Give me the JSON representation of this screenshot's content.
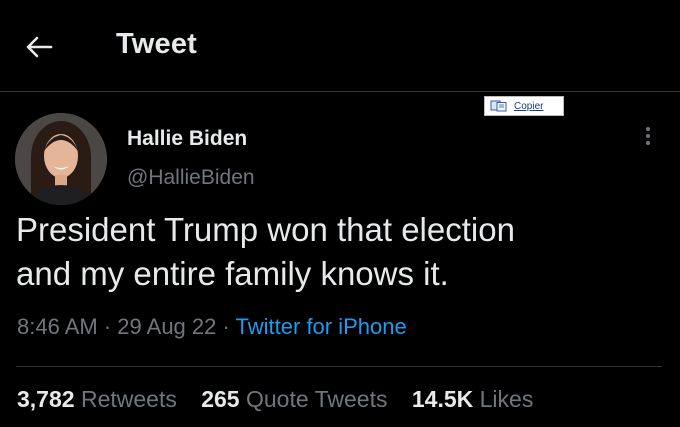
{
  "header": {
    "title": "Tweet",
    "back_icon": "arrow-left-icon"
  },
  "overlay": {
    "copier_label": "Copier",
    "copier_icon": "copy-icon"
  },
  "author": {
    "name": "Hallie Biden",
    "handle": "@HallieBiden"
  },
  "tweet": {
    "text_line1": "President Trump won that election",
    "text_line2": "and my entire family knows it.",
    "time": "8:46 AM",
    "sep1": " · ",
    "date": "29 Aug 22",
    "sep2": " · ",
    "source": "Twitter for iPhone"
  },
  "stats": {
    "retweets_count": "3,782",
    "retweets_label": "Retweets",
    "quotes_count": "265",
    "quotes_label": "Quote Tweets",
    "likes_count": "14.5K",
    "likes_label": "Likes"
  },
  "colors": {
    "background": "#000000",
    "text": "#e7e9ea",
    "muted": "#71767b",
    "accent": "#1d9bf0",
    "divider": "#2f3336"
  }
}
